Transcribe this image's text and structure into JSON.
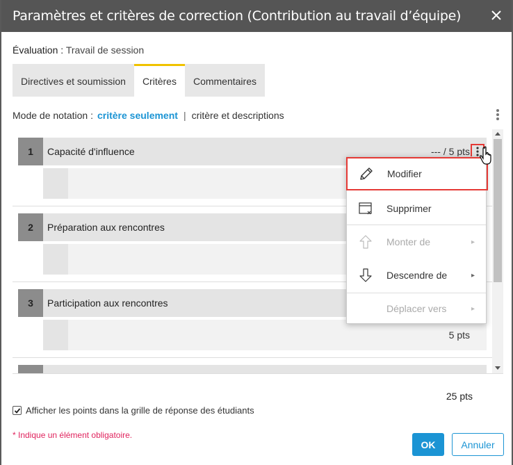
{
  "dialog": {
    "title": "Paramètres et critères de correction (Contribution au travail d’équipe)",
    "close_icon": "close-icon"
  },
  "evaluation": {
    "label": "Évaluation :",
    "value": "Travail de session"
  },
  "tabs": [
    {
      "label": "Directives et soumission",
      "active": false
    },
    {
      "label": "Critères",
      "active": true
    },
    {
      "label": "Commentaires",
      "active": false
    }
  ],
  "mode": {
    "label": "Mode de notation :",
    "active_option": "critère seulement",
    "separator": "|",
    "other_option": "critère et descriptions"
  },
  "criteria": [
    {
      "num": "1",
      "name": "Capacité d'influence",
      "score": "--- /  5  pts",
      "kebab_highlighted": true,
      "body_points": ""
    },
    {
      "num": "2",
      "name": "Préparation aux rencontres",
      "score": "",
      "body_points": ""
    },
    {
      "num": "3",
      "name": "Participation aux rencontres",
      "score": "",
      "body_points": "5  pts"
    }
  ],
  "total": "25  pts",
  "display_points": {
    "label": "Afficher les points dans la grille de réponse des étudiants",
    "checked": true
  },
  "required_note": "* Indique un élément obligatoire.",
  "buttons": {
    "ok": "OK",
    "cancel": "Annuler"
  },
  "context_menu": {
    "items": [
      {
        "label": "Modifier",
        "icon": "pencil-icon",
        "disabled": false,
        "submenu": false,
        "highlighted": true
      },
      {
        "label": "Supprimer",
        "icon": "delete-icon",
        "disabled": false,
        "submenu": false
      },
      {
        "label": "Monter de",
        "icon": "arrow-up-icon",
        "disabled": true,
        "submenu": true
      },
      {
        "label": "Descendre de",
        "icon": "arrow-down-icon",
        "disabled": false,
        "submenu": true
      },
      {
        "label": "Déplacer vers",
        "icon": "",
        "disabled": true,
        "submenu": true
      }
    ]
  },
  "colors": {
    "accent": "#1b94d4",
    "tab_indicator": "#f0c200",
    "highlight": "#e53935",
    "required": "#e0245e"
  }
}
